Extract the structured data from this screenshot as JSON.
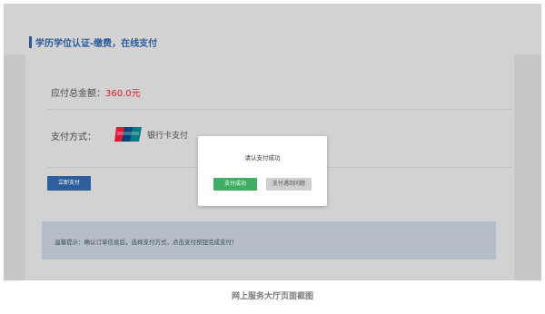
{
  "header": {
    "title": "学历学位认证-缴费，在线支付"
  },
  "order": {
    "amount_label": "应付总金额：",
    "amount_value": "360.0元"
  },
  "payment": {
    "method_label": "支付方式：",
    "bank_card_label": "银行卡支付",
    "logo_icon": "unionpay-logo-icon"
  },
  "actions": {
    "pay_now_label": "立即支付"
  },
  "tip": {
    "text": "温馨提示：确认订单信息后，选择支付方式，点击支付按钮完成支付！"
  },
  "dialog": {
    "message": "请认支付成功",
    "success_label": "支付成功",
    "problem_label": "支付遇到问题"
  },
  "caption": "网上服务大厅页面截图",
  "colors": {
    "accent": "#2a5a9a",
    "amount": "#e0191c",
    "success": "#3fae62"
  }
}
